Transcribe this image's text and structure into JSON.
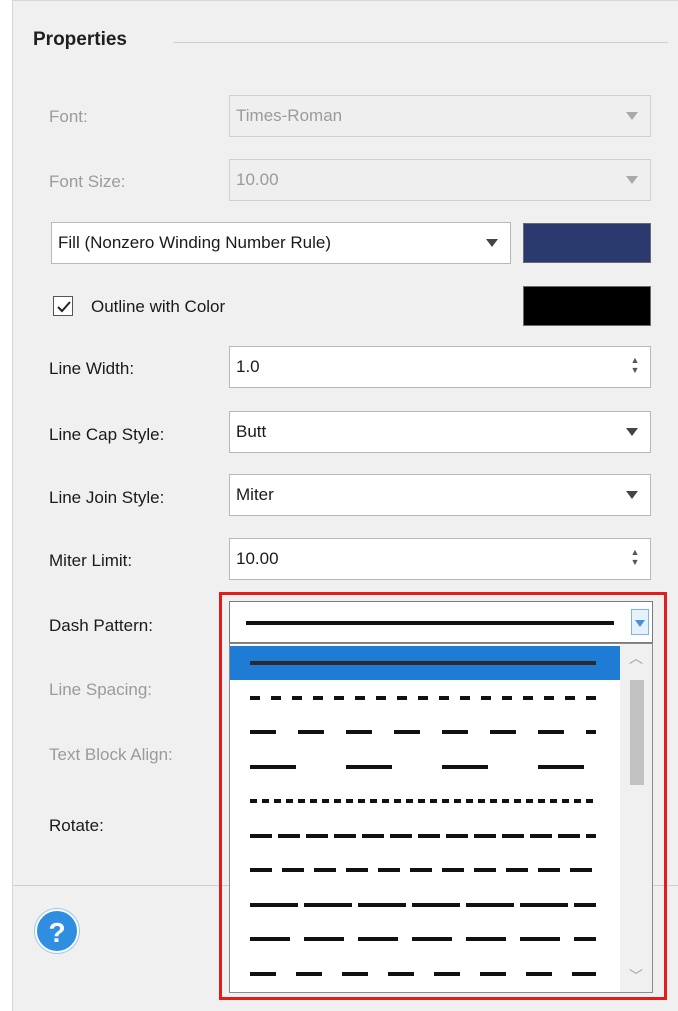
{
  "group": {
    "title": "Properties"
  },
  "font": {
    "label": "Font:",
    "value": "Times-Roman"
  },
  "font_size": {
    "label": "Font Size:",
    "value": "10.00"
  },
  "fill": {
    "value": "Fill (Nonzero Winding Number Rule)",
    "color": "#2a3a6e"
  },
  "outline": {
    "label": "Outline with Color",
    "checked": true,
    "color": "#000000"
  },
  "line_width": {
    "label": "Line Width:",
    "value": "1.0"
  },
  "line_cap": {
    "label": "Line Cap Style:",
    "value": "Butt"
  },
  "line_join": {
    "label": "Line Join Style:",
    "value": "Miter"
  },
  "miter_limit": {
    "label": "Miter Limit:",
    "value": "10.00"
  },
  "dash_pattern": {
    "label": "Dash Pattern:",
    "selected_index": 0,
    "options": [
      "solid",
      "dash-1",
      "dash-2",
      "dash-3",
      "dash-4",
      "dash-5",
      "dash-6",
      "dash-7",
      "dash-8",
      "dash-9"
    ]
  },
  "line_spacing": {
    "label": "Line Spacing:"
  },
  "text_block_align": {
    "label": "Text Block Align:"
  },
  "rotate": {
    "label": "Rotate:"
  },
  "colors": {
    "highlight": "#e21b1b",
    "selection": "#1e7cd4"
  },
  "icons": {
    "help": "?"
  }
}
